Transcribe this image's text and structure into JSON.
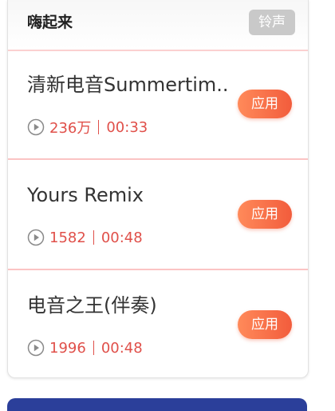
{
  "header": {
    "title": "嗨起来",
    "tag": "铃声"
  },
  "songs": [
    {
      "title": "清新电音Summertim..",
      "plays": "236万",
      "duration": "00:33",
      "button": "应用"
    },
    {
      "title": "Yours Remix",
      "plays": "1582",
      "duration": "00:48",
      "button": "应用"
    },
    {
      "title": "电音之王(伴奏)",
      "plays": "1996",
      "duration": "00:48",
      "button": "应用"
    }
  ],
  "colors": {
    "accent": "#f25c3c",
    "meta_text": "#e0504a",
    "divider": "#fbc4c4",
    "tag_bg": "#c9c9c9",
    "bottom_bar": "#2b3f9a"
  },
  "icons": {
    "play": "play-circle-icon"
  }
}
